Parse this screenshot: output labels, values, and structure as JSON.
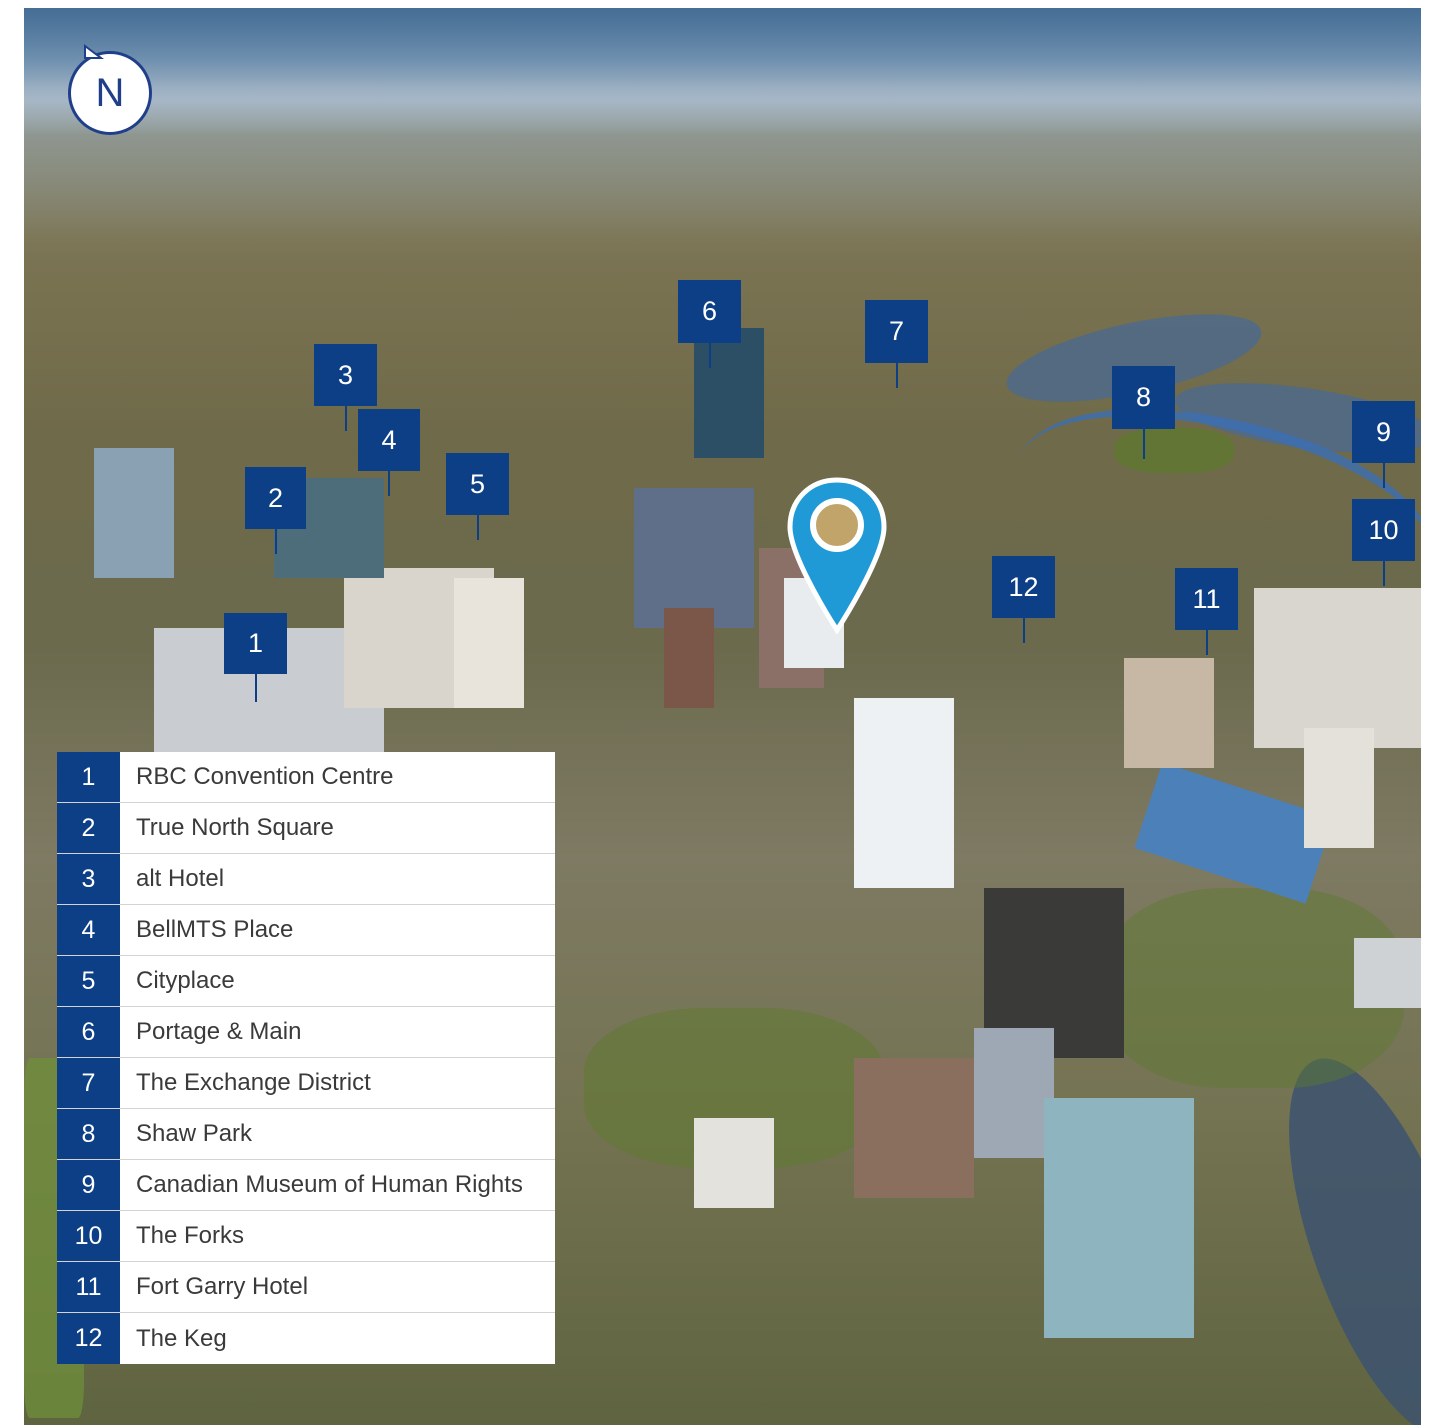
{
  "compass": {
    "label": "N"
  },
  "colors": {
    "marker": "#0d3f86",
    "pin": "#1f9ad6",
    "compass_border": "#1f3f8a"
  },
  "markers": [
    "1",
    "2",
    "3",
    "4",
    "5",
    "6",
    "7",
    "8",
    "9",
    "10",
    "11",
    "12"
  ],
  "legend": [
    {
      "num": "1",
      "name": "RBC Convention Centre"
    },
    {
      "num": "2",
      "name": "True North Square"
    },
    {
      "num": "3",
      "name": "alt Hotel"
    },
    {
      "num": "4",
      "name": "BellMTS Place"
    },
    {
      "num": "5",
      "name": "Cityplace"
    },
    {
      "num": "6",
      "name": "Portage & Main"
    },
    {
      "num": "7",
      "name": "The Exchange District"
    },
    {
      "num": "8",
      "name": "Shaw Park"
    },
    {
      "num": "9",
      "name": "Canadian Museum of Human Rights"
    },
    {
      "num": "10",
      "name": "The Forks"
    },
    {
      "num": "11",
      "name": "Fort Garry Hotel"
    },
    {
      "num": "12",
      "name": "The Keg"
    }
  ]
}
